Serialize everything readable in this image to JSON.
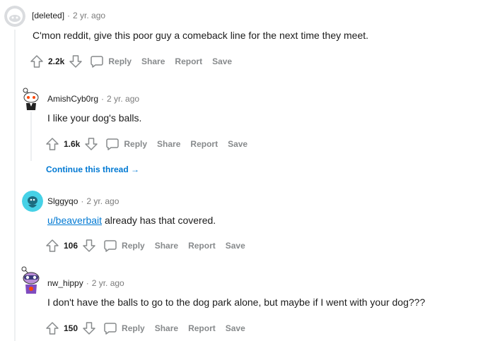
{
  "comments": [
    {
      "author": "[deleted]",
      "time": "2 yr. ago",
      "body": "C'mon reddit, give this poor guy a comeback line for the next time they meet.",
      "score": "2.2k"
    },
    {
      "author": "AmishCyb0rg",
      "time": "2 yr. ago",
      "body": "I like your dog's balls.",
      "score": "1.6k"
    },
    {
      "author": "Slggyqo",
      "time": "2 yr. ago",
      "body_link": "u/beaverbait",
      "body_rest": " already has that covered.",
      "score": "106"
    },
    {
      "author": "nw_hippy",
      "time": "2 yr. ago",
      "body": "I don't have the balls to go to the dog park alone, but maybe if I went with your dog???",
      "score": "150"
    }
  ],
  "actions": {
    "reply": "Reply",
    "share": "Share",
    "report": "Report",
    "save": "Save"
  },
  "separator": "·",
  "continue_thread": "Continue this thread",
  "continue_arrow": "→",
  "colors": {
    "meta_gray": "#7c7c7c",
    "action_gray": "#878a8c",
    "link_blue": "#0079d3",
    "thread_line": "#edeff1"
  }
}
